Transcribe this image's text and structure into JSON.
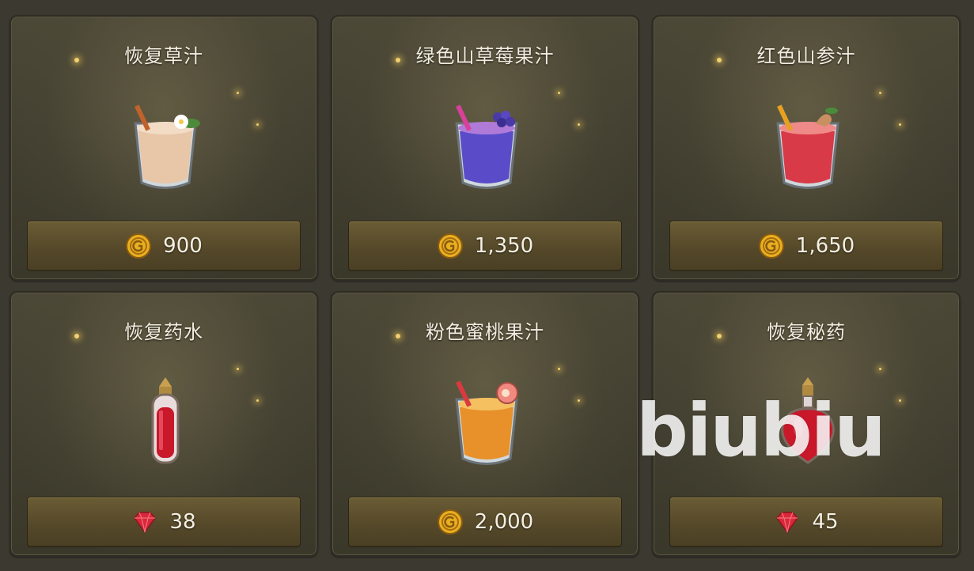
{
  "items": [
    {
      "name": "恢复草汁",
      "price": "900",
      "currency": "gold-coin-icon",
      "art": "herb-juice-icon"
    },
    {
      "name": "绿色山草莓果汁",
      "price": "1,350",
      "currency": "gold-coin-icon",
      "art": "berry-juice-icon"
    },
    {
      "name": "红色山参汁",
      "price": "1,650",
      "currency": "gold-coin-icon",
      "art": "ginseng-juice-icon"
    },
    {
      "name": "恢复药水",
      "price": "38",
      "currency": "ruby-gem-icon",
      "art": "potion-vial-icon"
    },
    {
      "name": "粉色蜜桃果汁",
      "price": "2,000",
      "currency": "gold-coin-icon",
      "art": "peach-juice-icon"
    },
    {
      "name": "恢复秘药",
      "price": "45",
      "currency": "ruby-gem-icon",
      "art": "elixir-flask-icon"
    }
  ],
  "watermark": "biubiu",
  "colors": {
    "gold": "#e8b020",
    "ruby": "#d8283a",
    "title_text": "#f2ede0"
  }
}
